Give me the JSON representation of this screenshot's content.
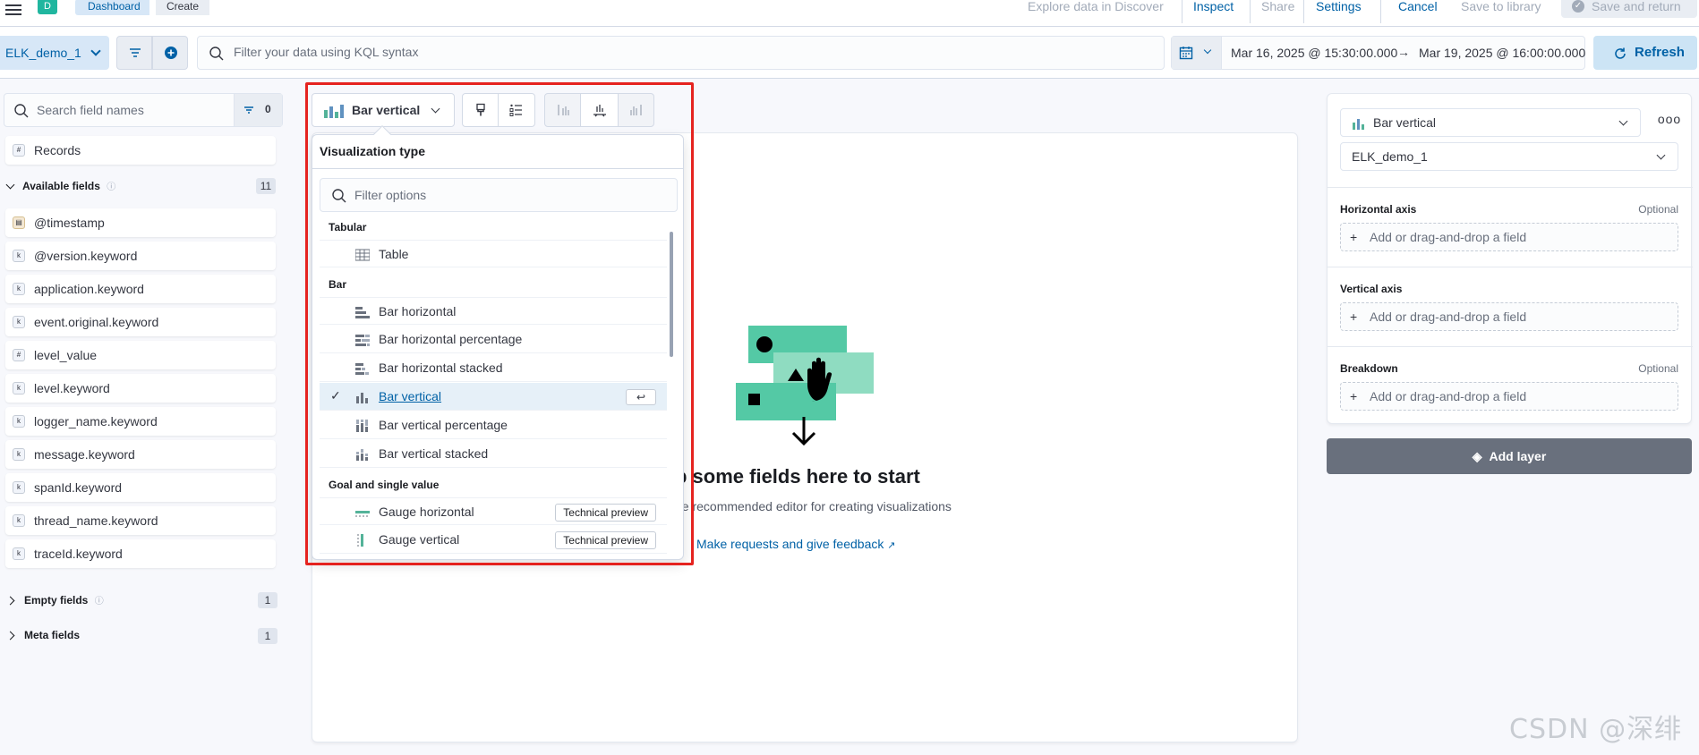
{
  "header": {
    "avatar_letter": "D",
    "breadcrumbs": [
      "Dashboard",
      "Create"
    ],
    "nav": {
      "explore": "Explore data in Discover",
      "inspect": "Inspect",
      "share": "Share",
      "settings": "Settings",
      "cancel": "Cancel",
      "save_to_library": "Save to library",
      "save_and_return": "Save and return"
    }
  },
  "query": {
    "data_view": "ELK_demo_1",
    "kql_placeholder": "Filter your data using KQL syntax",
    "date_start": "Mar 16, 2025 @ 15:30:00.000",
    "date_end": "Mar 19, 2025 @ 16:00:00.000",
    "refresh_label": "Refresh"
  },
  "sidebar": {
    "search_placeholder": "Search field names",
    "filter_count": "0",
    "records_label": "Records",
    "available_label": "Available fields",
    "available_count": "11",
    "fields": [
      {
        "name": "@timestamp",
        "type": "date"
      },
      {
        "name": "@version.keyword",
        "type": "k"
      },
      {
        "name": "application.keyword",
        "type": "k"
      },
      {
        "name": "event.original.keyword",
        "type": "k"
      },
      {
        "name": "level_value",
        "type": "#"
      },
      {
        "name": "level.keyword",
        "type": "k"
      },
      {
        "name": "logger_name.keyword",
        "type": "k"
      },
      {
        "name": "message.keyword",
        "type": "k"
      },
      {
        "name": "spanId.keyword",
        "type": "k"
      },
      {
        "name": "thread_name.keyword",
        "type": "k"
      },
      {
        "name": "traceId.keyword",
        "type": "k"
      }
    ],
    "empty_label": "Empty fields",
    "empty_count": "1",
    "meta_label": "Meta fields",
    "meta_count": "1"
  },
  "toolbar": {
    "chart_type": "Bar vertical"
  },
  "popover": {
    "title": "Visualization type",
    "filter_placeholder": "Filter options",
    "groups": {
      "tabular": "Tabular",
      "bar": "Bar",
      "goal": "Goal and single value"
    },
    "options": {
      "table": "Table",
      "bar_h": "Bar horizontal",
      "bar_h_pct": "Bar horizontal percentage",
      "bar_h_stacked": "Bar horizontal stacked",
      "bar_v": "Bar vertical",
      "bar_v_pct": "Bar vertical percentage",
      "bar_v_stacked": "Bar vertical stacked",
      "gauge_h": "Gauge horizontal",
      "gauge_v": "Gauge vertical"
    },
    "enter_key": "↩",
    "badge": "Technical preview"
  },
  "empty_state": {
    "title": "p some fields here to start",
    "subtitle": "he recommended editor for creating visualizations",
    "feedback_link": "Make requests and give feedback"
  },
  "config": {
    "chart_type": "Bar vertical",
    "data_view": "ELK_demo_1",
    "horizontal_axis": "Horizontal axis",
    "vertical_axis": "Vertical axis",
    "breakdown": "Breakdown",
    "optional": "Optional",
    "drop_placeholder": "Add or drag-and-drop a field",
    "add_layer": "Add layer"
  },
  "watermark": "CSDN @深绯",
  "colors": {
    "accent": "#0061a6",
    "success": "#20b69f",
    "highlight_red": "#e5231f"
  }
}
